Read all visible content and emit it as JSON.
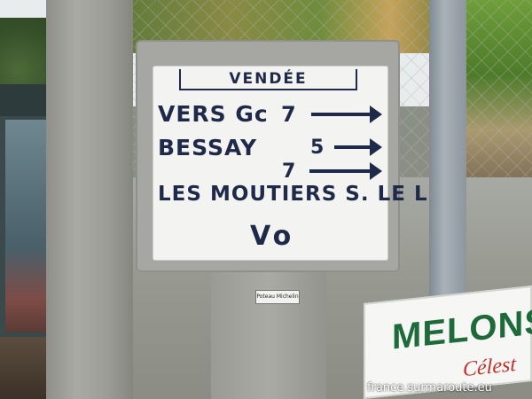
{
  "sign": {
    "department": "VENDÉE",
    "line1_text": "VERS Gc",
    "line1_num": "7",
    "line2_text": "BESSAY",
    "line2_num": "5",
    "line3_num": "7",
    "line3_text": "LES MOUTIERS S. LE L",
    "bottom": "Vo"
  },
  "plaque": {
    "text": "Poteau Michelin"
  },
  "melons_sign": {
    "title": "MELONS",
    "subtitle": "Célest"
  },
  "watermark": {
    "text": "france.surmaroute.eu"
  },
  "colors": {
    "sign_ink": "#1f2a4a",
    "melon_green": "#1e6a3b",
    "melon_red": "#c3302b"
  }
}
